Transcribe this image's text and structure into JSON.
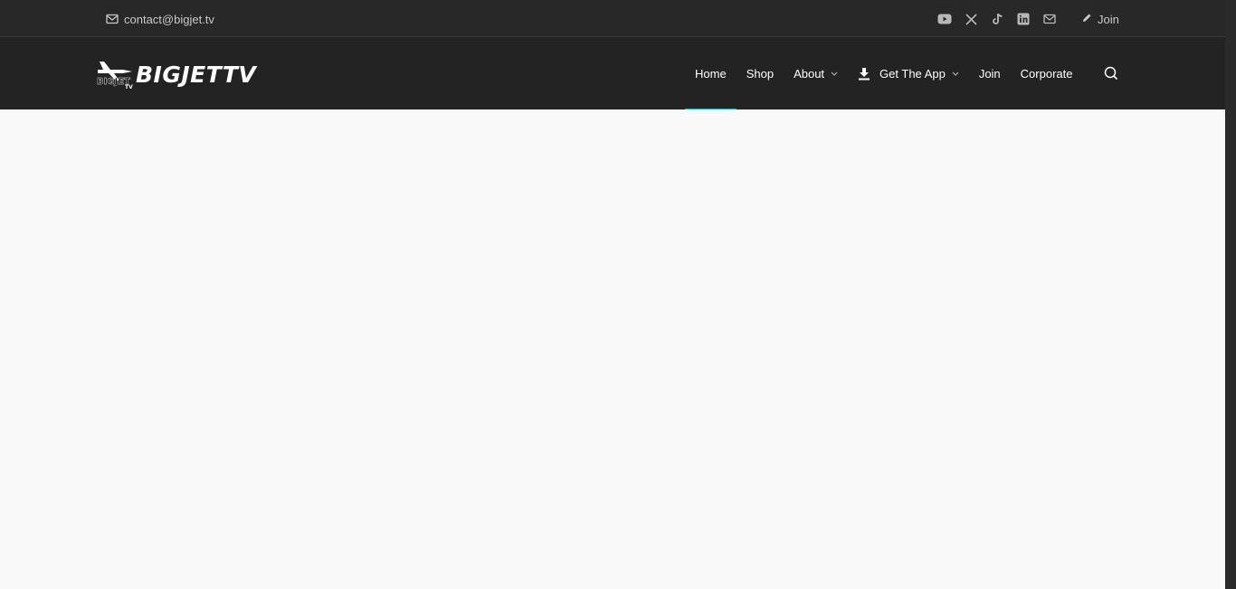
{
  "topbar": {
    "email": "contact@bigjet.tv",
    "join_label": "Join",
    "social_icons": [
      "youtube-icon",
      "x-icon",
      "tiktok-icon",
      "linkedin-icon",
      "mail-icon"
    ]
  },
  "brand": {
    "logo_text": "BIGJETTV",
    "logo_small_text": "BIGJET",
    "logo_small_sub": "TV"
  },
  "nav": {
    "items": [
      {
        "label": "Home",
        "active": true
      },
      {
        "label": "Shop"
      },
      {
        "label": "About",
        "dropdown": true
      },
      {
        "label": "Get The App",
        "dropdown": true,
        "icon": "download-icon"
      },
      {
        "label": "Join"
      },
      {
        "label": "Corporate"
      }
    ]
  },
  "colors": {
    "topbar_bg": "#282828",
    "navbar_bg": "#232323",
    "accent": "#19b8c9",
    "page_bg": "#f9f9f9"
  }
}
